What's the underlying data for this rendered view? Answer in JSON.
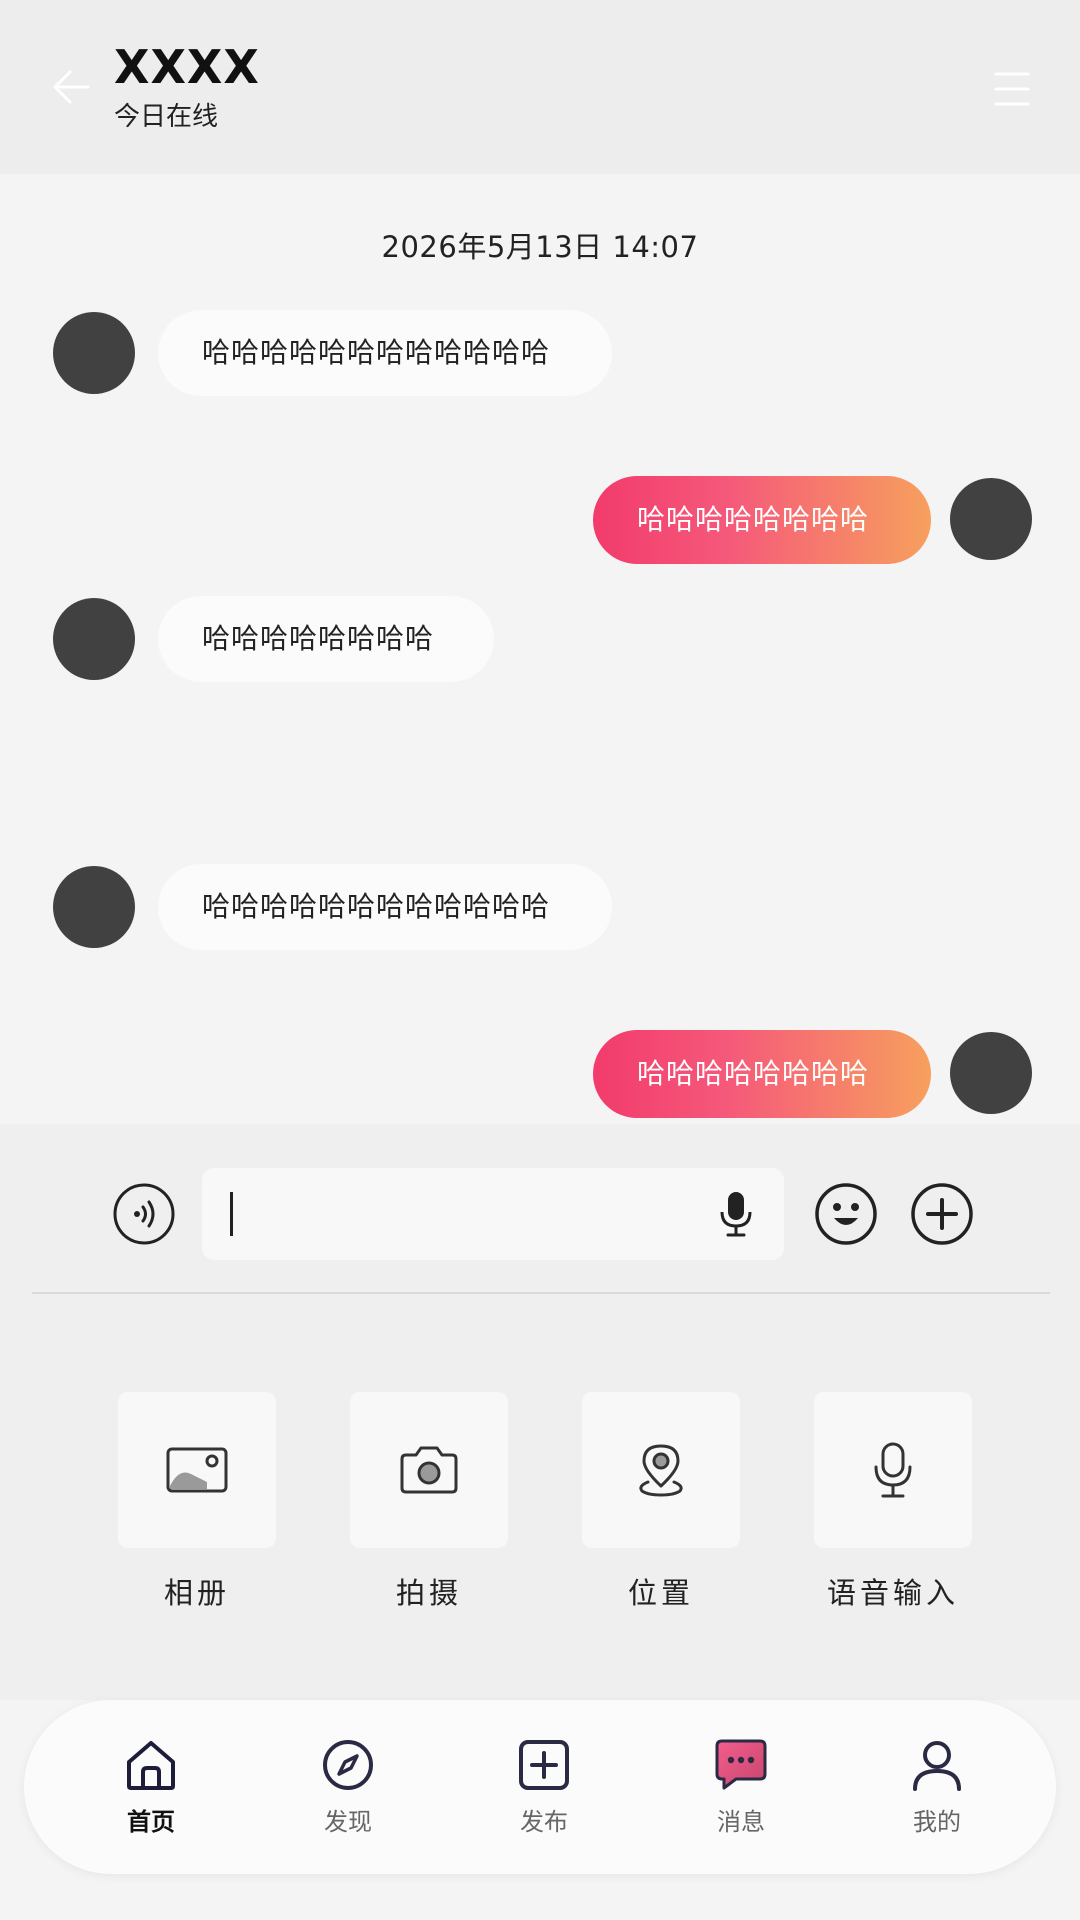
{
  "header": {
    "title": "XXXX",
    "status": "今日在线"
  },
  "chat": {
    "timestamp": "2026年5月13日 14:07",
    "messages": [
      {
        "side": "in",
        "text": "哈哈哈哈哈哈哈哈哈哈哈哈"
      },
      {
        "side": "out",
        "text": "哈哈哈哈哈哈哈哈"
      },
      {
        "side": "in",
        "text": "哈哈哈哈哈哈哈哈"
      },
      {
        "side": "in",
        "text": "哈哈哈哈哈哈哈哈哈哈哈哈"
      },
      {
        "side": "out",
        "text": "哈哈哈哈哈哈哈哈"
      }
    ]
  },
  "composer": {
    "input_value": "",
    "icons": [
      "voice-icon",
      "mic-icon",
      "emoji-icon",
      "plus-icon"
    ]
  },
  "tools": [
    {
      "label": "相册",
      "icon": "album-icon"
    },
    {
      "label": "拍摄",
      "icon": "camera-icon"
    },
    {
      "label": "位置",
      "icon": "location-icon"
    },
    {
      "label": "语音输入",
      "icon": "microphone-icon"
    }
  ],
  "tabbar": {
    "active": "首页",
    "items": [
      {
        "label": "首页",
        "icon": "home-icon"
      },
      {
        "label": "发现",
        "icon": "compass-icon"
      },
      {
        "label": "发布",
        "icon": "add-square-icon"
      },
      {
        "label": "消息",
        "icon": "message-icon"
      },
      {
        "label": "我的",
        "icon": "user-icon"
      }
    ]
  },
  "colors": {
    "outgoing_gradient_start": "#f23b6c",
    "outgoing_gradient_end": "#f7a05e",
    "avatar": "#414141",
    "background": "#f4f4f5"
  }
}
